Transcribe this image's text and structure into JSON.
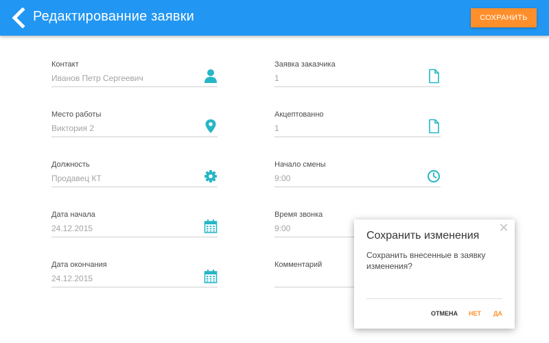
{
  "header": {
    "title": "Редактированние заявки",
    "save_label": "СОХРАНИТЬ"
  },
  "form": {
    "left": [
      {
        "label": "Контакт",
        "value": "Иванов Петр Сергеевич",
        "icon": "person-icon"
      },
      {
        "label": "Место работы",
        "value": "Виктория 2",
        "icon": "location-pin-icon"
      },
      {
        "label": "Должность",
        "value": "Продавец КТ",
        "icon": "gear-icon"
      },
      {
        "label": "Дата начала",
        "value": "24.12.2015",
        "icon": "calendar-icon"
      },
      {
        "label": "Дата окончания",
        "value": "24.12.2015",
        "icon": "calendar-icon"
      }
    ],
    "right": [
      {
        "label": "Заявка заказчика",
        "value": "1",
        "icon": "document-icon"
      },
      {
        "label": "Акцептованно",
        "value": "1",
        "icon": "document-icon"
      },
      {
        "label": "Начало смены",
        "value": "9:00",
        "icon": "clock-icon"
      },
      {
        "label": "Время звонка",
        "value": "9:00",
        "icon": ""
      },
      {
        "label": "Комментарий",
        "value": "",
        "icon": ""
      }
    ]
  },
  "dialog": {
    "title": "Сохранить изменения",
    "message": "Сохранить внесенные в заявку изменения?",
    "cancel_label": "ОТМЕНА",
    "no_label": "НЕТ",
    "yes_label": "ДА",
    "close_symbol": "✕"
  },
  "colors": {
    "header": "#2196f3",
    "accent_orange": "#ff8f2b",
    "icon_teal": "#26b6c6"
  }
}
